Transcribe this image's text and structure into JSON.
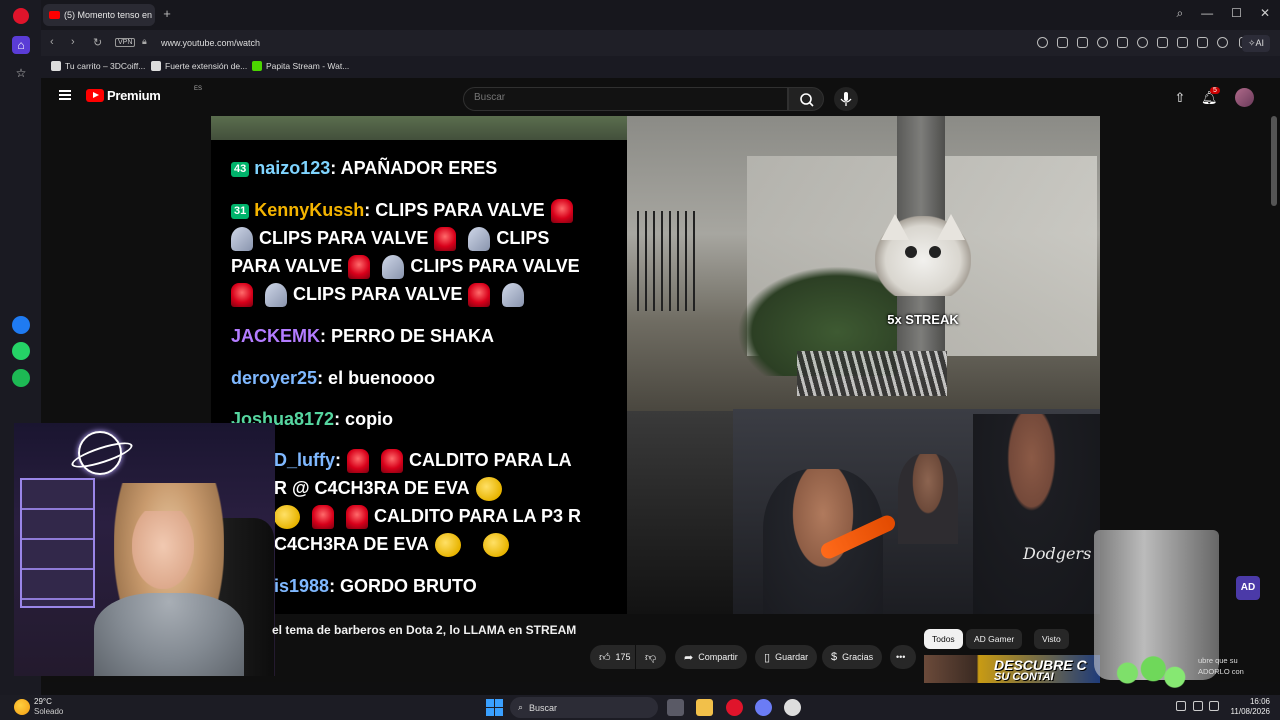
{
  "browser": {
    "tab_title": "(5) Momento tenso en",
    "url": "www.youtube.com/watch",
    "vpn_label": "VPN",
    "ai_label": "AI",
    "bookmarks": [
      {
        "label": "Tu carrito – 3DCoiff..."
      },
      {
        "label": "Fuerte extensión de..."
      },
      {
        "label": "Papita Stream - Wat..."
      }
    ]
  },
  "youtube": {
    "logo_text": "Premium",
    "logo_region": "ES",
    "search_placeholder": "Buscar",
    "notification_count": "5"
  },
  "chat": {
    "messages": [
      {
        "badge": "43",
        "user": "naizo123",
        "user_color": "#7fd4ff",
        "text": ": APAÑADOR ERES"
      },
      {
        "badge": "31",
        "user": "KennyKussh",
        "user_color": "#f4b400",
        "text": ": CLIPS PARA VALVE"
      },
      {
        "text": "CLIPS PARA VALVE",
        "text2": "CLIPS"
      },
      {
        "text": "PARA VALVE",
        "text2": "CLIPS PARA VALVE"
      },
      {
        "text": "CLIPS PARA VALVE"
      },
      {
        "user": "JACKEMK",
        "user_color": "#b37cff",
        "text": ": PERRO DE SHAKA"
      },
      {
        "user": "deroyer25",
        "user_color": "#7fb8ff",
        "text": ": el buenoooo"
      },
      {
        "user": "Joshua8172",
        "user_color": "#56d6a0",
        "text": ": copio"
      },
      {
        "user": "D_luffy",
        "user_color": "#7fb8ff",
        "text": ":",
        "text2": "CALDITO PARA LA"
      },
      {
        "text": "R @ C4CH3RA DE EVA"
      },
      {
        "text": "CALDITO PARA LA P3 R"
      },
      {
        "text": "C4CH3RA DE EVA"
      },
      {
        "user": "is1988",
        "user_color": "#7fb8ff",
        "text": ": GORDO BRUTO"
      }
    ]
  },
  "video_overlay": {
    "streak_text": "5x STREAK",
    "jersey_text": "Dodgers"
  },
  "video": {
    "title": "el tema de barberos en Dota 2, lo LLAMA en STREAM",
    "like_count": "175",
    "share_label": "Compartir",
    "save_label": "Guardar",
    "thanks_label": "Gracias",
    "more_label": "•••"
  },
  "recommendations": {
    "chips": [
      {
        "label": "Todos",
        "active": true
      },
      {
        "label": "AD Gamer",
        "active": false
      },
      {
        "label": "Visto",
        "active": false
      }
    ],
    "thumb_text": "DESCUBRE C",
    "thumb_text2": "SU CONTAI",
    "side_text1": "ubre que su",
    "side_text2": "ADORLO con",
    "channel_badge": "AD"
  },
  "taskbar": {
    "temperature": "29°C",
    "weather": "Soleado",
    "search_label": "Buscar",
    "time": "16:06",
    "date": "11/08/2026"
  },
  "colors": {
    "accent_red": "#ff0000",
    "chat_badge": "#00b36b"
  }
}
